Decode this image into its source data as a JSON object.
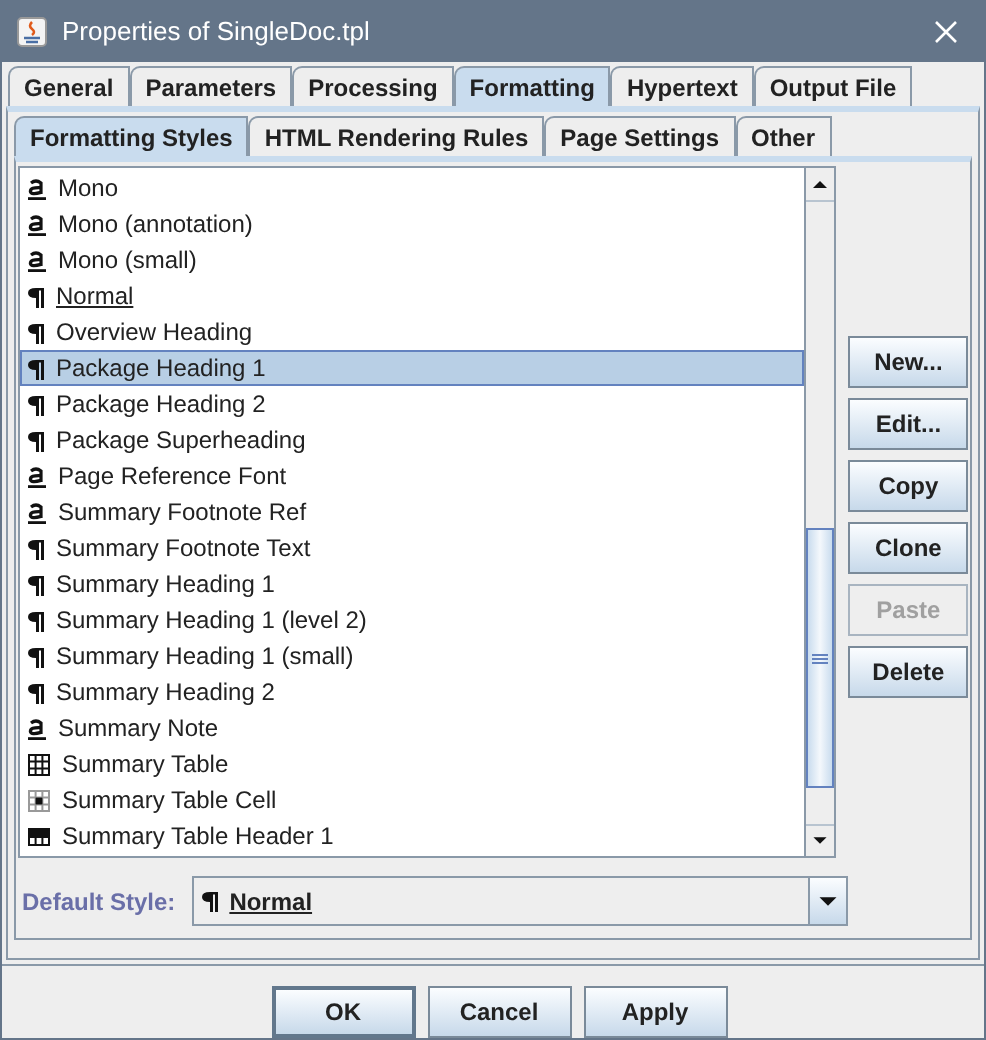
{
  "window": {
    "title": "Properties of SingleDoc.tpl"
  },
  "tabs": [
    {
      "label": "General",
      "selected": false
    },
    {
      "label": "Parameters",
      "selected": false
    },
    {
      "label": "Processing",
      "selected": false
    },
    {
      "label": "Formatting",
      "selected": true
    },
    {
      "label": "Hypertext",
      "selected": false
    },
    {
      "label": "Output File",
      "selected": false
    }
  ],
  "subtabs": [
    {
      "label": "Formatting Styles",
      "selected": true
    },
    {
      "label": "HTML Rendering Rules",
      "selected": false
    },
    {
      "label": "Page Settings",
      "selected": false
    },
    {
      "label": "Other",
      "selected": false
    }
  ],
  "styles": [
    {
      "kind": "character",
      "name": "Mono",
      "selected": false,
      "default": false
    },
    {
      "kind": "character",
      "name": "Mono (annotation)",
      "selected": false,
      "default": false
    },
    {
      "kind": "character",
      "name": "Mono (small)",
      "selected": false,
      "default": false
    },
    {
      "kind": "paragraph",
      "name": "Normal",
      "selected": false,
      "default": true
    },
    {
      "kind": "paragraph",
      "name": "Overview Heading",
      "selected": false,
      "default": false
    },
    {
      "kind": "paragraph",
      "name": "Package Heading 1",
      "selected": true,
      "default": false
    },
    {
      "kind": "paragraph",
      "name": "Package Heading 2",
      "selected": false,
      "default": false
    },
    {
      "kind": "paragraph",
      "name": "Package Superheading",
      "selected": false,
      "default": false
    },
    {
      "kind": "character",
      "name": "Page Reference Font",
      "selected": false,
      "default": false
    },
    {
      "kind": "character",
      "name": "Summary Footnote Ref",
      "selected": false,
      "default": false
    },
    {
      "kind": "paragraph",
      "name": "Summary Footnote Text",
      "selected": false,
      "default": false
    },
    {
      "kind": "paragraph",
      "name": "Summary Heading 1",
      "selected": false,
      "default": false
    },
    {
      "kind": "paragraph",
      "name": "Summary Heading 1 (level 2)",
      "selected": false,
      "default": false
    },
    {
      "kind": "paragraph",
      "name": "Summary Heading 1 (small)",
      "selected": false,
      "default": false
    },
    {
      "kind": "paragraph",
      "name": "Summary Heading 2",
      "selected": false,
      "default": false
    },
    {
      "kind": "character",
      "name": "Summary Note",
      "selected": false,
      "default": false
    },
    {
      "kind": "table",
      "name": "Summary Table",
      "selected": false,
      "default": false
    },
    {
      "kind": "cell",
      "name": "Summary Table Cell",
      "selected": false,
      "default": false
    },
    {
      "kind": "row",
      "name": "Summary Table Header 1",
      "selected": false,
      "default": false
    }
  ],
  "side_buttons": [
    {
      "label": "New...",
      "disabled": false
    },
    {
      "label": "Edit...",
      "disabled": false
    },
    {
      "label": "Copy",
      "disabled": false
    },
    {
      "label": "Clone",
      "disabled": false
    },
    {
      "label": "Paste",
      "disabled": true
    },
    {
      "label": "Delete",
      "disabled": false
    }
  ],
  "default_style": {
    "label": "Default Style:",
    "kind": "paragraph",
    "value": "Normal"
  },
  "buttons": [
    {
      "label": "OK",
      "default": true
    },
    {
      "label": "Cancel",
      "default": false
    },
    {
      "label": "Apply",
      "default": false
    }
  ]
}
